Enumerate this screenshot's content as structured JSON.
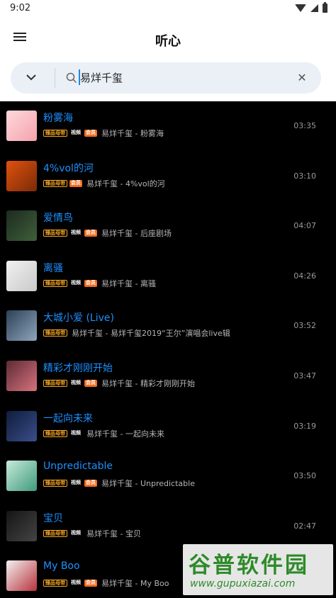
{
  "status_bar": {
    "time": "9:02"
  },
  "app_bar": {
    "title": "听心"
  },
  "search": {
    "query": "易烊千玺"
  },
  "badges": {
    "hq": "臻品母带",
    "video": "视频",
    "vip": "会员"
  },
  "songs": [
    {
      "title": "粉雾海",
      "desc": "易烊千玺 - 粉雾海",
      "duration": "03:35",
      "badges": [
        "hq",
        "video",
        "vip"
      ],
      "art": [
        "#ffd9dd",
        "#f3a2ad"
      ]
    },
    {
      "title": "4%vol的河",
      "desc": "易烊千玺 - 4%vol的河",
      "duration": "03:10",
      "badges": [
        "hq",
        "vip"
      ],
      "art": [
        "#e0520f",
        "#7a2a07"
      ]
    },
    {
      "title": "爱情鸟",
      "desc": "易烊千玺 - 后座剧场",
      "duration": "04:07",
      "badges": [
        "hq",
        "video",
        "vip"
      ],
      "art": [
        "#1c2b1f",
        "#3f5f3a"
      ]
    },
    {
      "title": "离骚",
      "desc": "易烊千玺 - 离骚",
      "duration": "04:26",
      "badges": [
        "hq",
        "video",
        "vip"
      ],
      "art": [
        "#f1f1f1",
        "#c9c9c9"
      ]
    },
    {
      "title": "大城小爱 (Live)",
      "desc": "易烊千玺 - 易烊千玺2019“王尔”演唱会live辑",
      "duration": "03:52",
      "badges": [
        "hq"
      ],
      "art": [
        "#2c4156",
        "#8ea5bd"
      ]
    },
    {
      "title": "精彩才刚刚开始",
      "desc": "易烊千玺 - 精彩才刚刚开始",
      "duration": "03:47",
      "badges": [
        "hq",
        "video",
        "vip"
      ],
      "art": [
        "#5d2b34",
        "#d7727e"
      ]
    },
    {
      "title": "一起向未来",
      "desc": "易烊千玺 - 一起向未来",
      "duration": "03:19",
      "badges": [
        "hq",
        "video"
      ],
      "art": [
        "#0f1c3a",
        "#3a4e8a"
      ]
    },
    {
      "title": "Unpredictable",
      "desc": "易烊千玺 - Unpredictable",
      "duration": "03:50",
      "badges": [
        "hq",
        "video",
        "vip"
      ],
      "art": [
        "#c7ead9",
        "#3f9a7f"
      ]
    },
    {
      "title": "宝贝",
      "desc": "易烊千玺 - 宝贝",
      "duration": "02:47",
      "badges": [
        "hq",
        "video"
      ],
      "art": [
        "#151515",
        "#444444"
      ]
    },
    {
      "title": "My Boo",
      "desc": "易烊千玺 - My Boo",
      "duration": "",
      "badges": [
        "hq",
        "video",
        "vip"
      ],
      "art": [
        "#f2f2f2",
        "#b8323c"
      ]
    }
  ],
  "watermark": {
    "brand": "谷普软件园",
    "url": "www.gupuxiazai.com"
  },
  "colors": {
    "accent": "#1e90ff",
    "hq": "#f5a623",
    "video": "#2ecc71",
    "vip": "#f36d21"
  }
}
